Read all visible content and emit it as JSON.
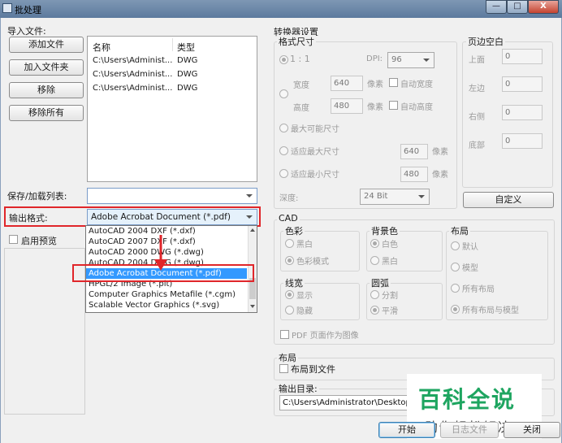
{
  "window": {
    "title": "批处理",
    "minimize_label": "—",
    "maximize_label": "□",
    "close_label": "X"
  },
  "import": {
    "section_label": "导入文件:",
    "add_file": "添加文件",
    "add_folder": "加入文件夹",
    "remove": "移除",
    "remove_all": "移除所有",
    "columns": [
      "名称",
      "类型"
    ],
    "files": [
      {
        "name": "C:\\Users\\Administ...",
        "type": "DWG"
      },
      {
        "name": "C:\\Users\\Administ...",
        "type": "DWG"
      },
      {
        "name": "C:\\Users\\Administ...",
        "type": "DWG"
      }
    ]
  },
  "save_load": {
    "label": "保存/加载列表:",
    "value": ""
  },
  "output_format": {
    "label": "输出格式:",
    "value": "Adobe Acrobat Document (*.pdf)",
    "options": [
      {
        "label": "AutoCAD 2004 DXF (*.dxf)"
      },
      {
        "label": "AutoCAD 2007 DXF (*.dxf)"
      },
      {
        "label": "AutoCAD 2000 DWG (*.dwg)"
      },
      {
        "label": "AutoCAD 2004 DWG (*.dwg)"
      },
      {
        "label": "Adobe Acrobat Document (*.pdf)",
        "selected": true
      },
      {
        "label": "HPGL/2 Image (*.plt)"
      },
      {
        "label": "Computer Graphics Metafile (*.cgm)"
      },
      {
        "label": "Scalable Vector Graphics (*.svg)"
      }
    ]
  },
  "preview": {
    "label": "启用预览"
  },
  "converter": {
    "title": "转换器设置",
    "format_size": {
      "title": "格式尺寸",
      "ratio_label": "1 : 1",
      "dpi_label": "DPI:",
      "dpi_value": "96",
      "width_label": "宽度",
      "width_value": "640",
      "height_label": "高度",
      "height_value": "480",
      "unit": "像素",
      "auto_width": "自动宽度",
      "auto_height": "自动高度",
      "max_size": "最大可能尺寸",
      "fit_max": "适应最大尺寸",
      "fit_max_value": "640",
      "fit_min": "适应最小尺寸",
      "fit_min_value": "480",
      "depth_label": "深度:",
      "depth_value": "24 Bit"
    },
    "margins": {
      "title": "页边空白",
      "top": "上面",
      "top_value": "0",
      "left": "左边",
      "left_value": "0",
      "right": "右侧",
      "right_value": "0",
      "bottom": "底部",
      "bottom_value": "0",
      "custom": "自定义"
    },
    "cad": {
      "title": "CAD",
      "color": {
        "title": "色彩",
        "options": [
          "黑白",
          "色彩模式"
        ]
      },
      "background": {
        "title": "背景色",
        "options": [
          "白色",
          "黑白"
        ]
      },
      "layout": {
        "title": "布局",
        "options": [
          "默认",
          "模型",
          "所有布局",
          "所有布局与模型"
        ]
      },
      "lineweight": {
        "title": "线宽",
        "options": [
          "显示",
          "隐藏"
        ]
      },
      "arc": {
        "title": "圆弧",
        "options": [
          "分割",
          "平滑"
        ]
      },
      "pdf_as_image": "PDF 页面作为图像"
    },
    "layout_group": {
      "title": "布局",
      "layout_to_file": "布局到文件"
    },
    "output_dir": {
      "label": "输出目录:",
      "value": "C:\\Users\\Administrator\\Desktop"
    }
  },
  "footer": {
    "start": "开始",
    "log": "日志文件",
    "close": "关闭"
  },
  "watermark": {
    "line1": "百科全说",
    "line2": "助你轻松解决"
  },
  "colors": {
    "highlight": "#3399ff",
    "annotation_red": "#e0262a",
    "watermark_green": "#1ea560"
  }
}
